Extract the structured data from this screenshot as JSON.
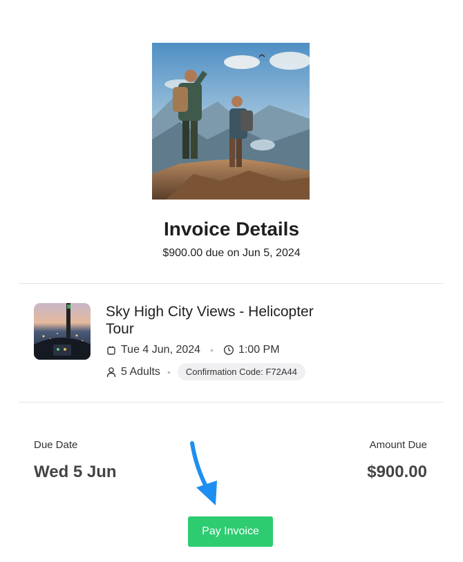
{
  "invoice": {
    "title": "Invoice Details",
    "subtitle": "$900.00 due on Jun 5, 2024"
  },
  "booking": {
    "tour_name": "Sky High City Views - Helicopter Tour",
    "date": "Tue 4 Jun, 2024",
    "time": "1:00 PM",
    "guests": "5 Adults",
    "confirmation": "Confirmation Code: F72A44"
  },
  "summary": {
    "due_date_label": "Due Date",
    "due_date_value": "Wed 5 Jun",
    "amount_label": "Amount Due",
    "amount_value": "$900.00"
  },
  "actions": {
    "pay_label": "Pay Invoice"
  },
  "icons": {
    "date": "calendar-icon",
    "time": "clock-icon",
    "guests": "person-icon",
    "annotation": "arrow-down-icon"
  },
  "colors": {
    "pay_button": "#2ecc71",
    "annotation_arrow": "#1e8ff0"
  }
}
